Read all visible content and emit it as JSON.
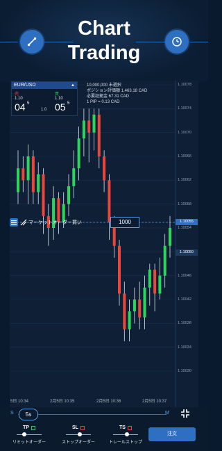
{
  "hero": {
    "title_line1": "Chart",
    "title_line2": "Trading",
    "left_icon": "draw-trendline-icon",
    "right_icon": "clock-icon"
  },
  "ticket": {
    "pair": "EUR/USD",
    "sell_label": "売",
    "buy_label": "買",
    "sell_small": "1.10",
    "sell_big": "04",
    "sell_sup": "5",
    "buy_small": "1.10",
    "buy_big": "05",
    "buy_sup": "5",
    "spread": "1.0"
  },
  "info": {
    "line1": "10,000,000 未選択",
    "line2": "ポジション評価額 1,463.18 CAD",
    "line3": "必要証拠金 67.31 CAD",
    "line4": "1 PIP = 0.13 CAD"
  },
  "order_bar": {
    "label": "マーケットオーダー買い",
    "quantity": "1000"
  },
  "axis": {
    "price_labels": [
      "1.10078",
      "1.10074",
      "1.10070",
      "1.10066",
      "1.10062",
      "1.10058",
      "1.10054",
      "1.10050",
      "1.10046",
      "1.10042",
      "1.10038",
      "1.10034",
      "1.10030"
    ],
    "current_price": "1.10055",
    "bid_price": "1.10050"
  },
  "time_labels": [
    "5日 10:34",
    "2月5日 10:35",
    "2月5日 10:36",
    "2月5日 10:37"
  ],
  "timeframe": {
    "value": "5s",
    "min_label": "S",
    "max_label": "M"
  },
  "options": [
    {
      "name": "TP",
      "label": "リミットオーダー",
      "color": "#2bd65c"
    },
    {
      "name": "SL",
      "label": "ストップオーダー",
      "color": "#e8473a"
    },
    {
      "name": "TS",
      "label": "トレールストップ",
      "color": "#e8473a"
    }
  ],
  "order_button": "注文",
  "chart_data": {
    "type": "candlestick",
    "title": "EUR/USD",
    "up_color": "#2bd65c",
    "down_color": "#e8473a",
    "ylim": [
      1.10026,
      1.1008
    ],
    "candles": [
      {
        "o": 1.1006,
        "c": 1.10064,
        "h": 1.10067,
        "l": 1.10058
      },
      {
        "o": 1.10064,
        "c": 1.10062,
        "h": 1.10066,
        "l": 1.1006
      },
      {
        "o": 1.10062,
        "c": 1.10066,
        "h": 1.10068,
        "l": 1.10058
      },
      {
        "o": 1.10066,
        "c": 1.1006,
        "h": 1.10067,
        "l": 1.10058
      },
      {
        "o": 1.1006,
        "c": 1.10063,
        "h": 1.10065,
        "l": 1.10058
      },
      {
        "o": 1.10063,
        "c": 1.10056,
        "h": 1.10064,
        "l": 1.10053
      },
      {
        "o": 1.10056,
        "c": 1.10054,
        "h": 1.10058,
        "l": 1.10051
      },
      {
        "o": 1.10054,
        "c": 1.10059,
        "h": 1.10061,
        "l": 1.10052
      },
      {
        "o": 1.10059,
        "c": 1.10055,
        "h": 1.1006,
        "l": 1.10053
      },
      {
        "o": 1.10055,
        "c": 1.10058,
        "h": 1.1006,
        "l": 1.10054
      },
      {
        "o": 1.10058,
        "c": 1.10061,
        "h": 1.10063,
        "l": 1.10056
      },
      {
        "o": 1.10061,
        "c": 1.10064,
        "h": 1.10067,
        "l": 1.10059
      },
      {
        "o": 1.10064,
        "c": 1.10069,
        "h": 1.10071,
        "l": 1.10062
      },
      {
        "o": 1.10069,
        "c": 1.10072,
        "h": 1.10074,
        "l": 1.10066
      },
      {
        "o": 1.10072,
        "c": 1.1007,
        "h": 1.10074,
        "l": 1.10065
      },
      {
        "o": 1.1007,
        "c": 1.10073,
        "h": 1.10074,
        "l": 1.10067
      },
      {
        "o": 1.10073,
        "c": 1.10066,
        "h": 1.10074,
        "l": 1.10064
      },
      {
        "o": 1.10066,
        "c": 1.10062,
        "h": 1.10067,
        "l": 1.1006
      },
      {
        "o": 1.10062,
        "c": 1.10055,
        "h": 1.10063,
        "l": 1.10052
      },
      {
        "o": 1.10055,
        "c": 1.10051,
        "h": 1.10056,
        "l": 1.10049
      },
      {
        "o": 1.10051,
        "c": 1.10043,
        "h": 1.10052,
        "l": 1.10041
      },
      {
        "o": 1.10043,
        "c": 1.10037,
        "h": 1.10045,
        "l": 1.10035
      },
      {
        "o": 1.10037,
        "c": 1.1004,
        "h": 1.10042,
        "l": 1.10035
      },
      {
        "o": 1.1004,
        "c": 1.10042,
        "h": 1.10044,
        "l": 1.10038
      },
      {
        "o": 1.10042,
        "c": 1.10039,
        "h": 1.10045,
        "l": 1.10037
      },
      {
        "o": 1.10039,
        "c": 1.10044,
        "h": 1.10046,
        "l": 1.10037
      },
      {
        "o": 1.10044,
        "c": 1.10047,
        "h": 1.10048,
        "l": 1.10041
      },
      {
        "o": 1.10047,
        "c": 1.10043,
        "h": 1.10048,
        "l": 1.1004
      },
      {
        "o": 1.10043,
        "c": 1.10046,
        "h": 1.10049,
        "l": 1.10042
      },
      {
        "o": 1.10046,
        "c": 1.10051,
        "h": 1.10053,
        "l": 1.10044
      },
      {
        "o": 1.10051,
        "c": 1.10054,
        "h": 1.10056,
        "l": 1.10049
      }
    ]
  }
}
